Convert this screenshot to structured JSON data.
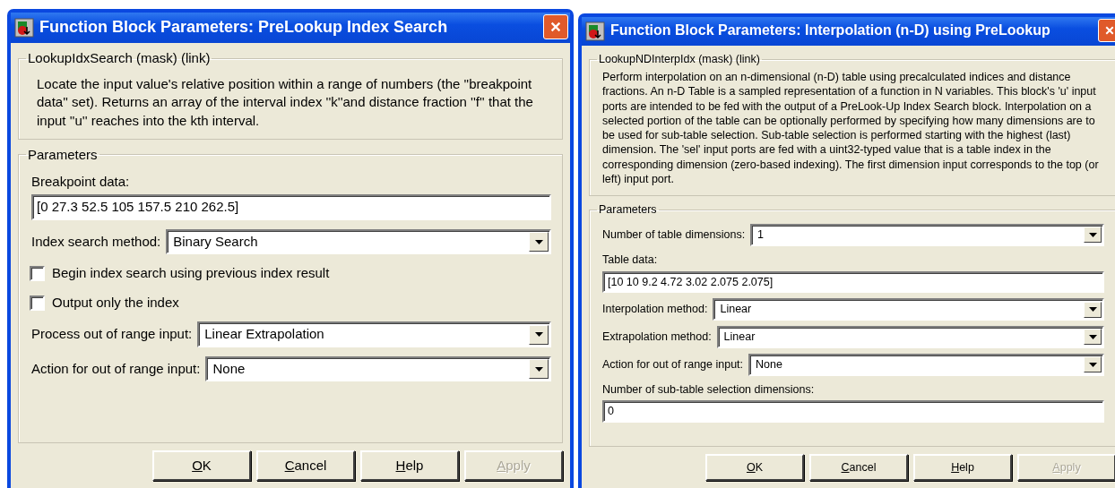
{
  "windows": [
    {
      "title": "Function Block Parameters: PreLookup Index Search",
      "description": {
        "legend": "LookupIdxSearch (mask) (link)",
        "text": "Locate the input value's relative position within a range of numbers (the ''breakpoint data'' set).  Returns an array of the interval index ''k''and distance fraction ''f'' that the input ''u'' reaches into the kth interval."
      },
      "parameters": {
        "legend": "Parameters",
        "items": [
          {
            "kind": "text",
            "label": "Breakpoint data:",
            "value": "[0 27.3 52.5 105 157.5 210 262.5]"
          },
          {
            "kind": "select",
            "label": "Index search method:",
            "value": "Binary Search"
          },
          {
            "kind": "checkbox",
            "label": "Begin index search using previous index result",
            "checked": false
          },
          {
            "kind": "checkbox",
            "label": "Output only the index",
            "checked": false
          },
          {
            "kind": "select",
            "label": "Process out of range input:",
            "value": "Linear Extrapolation"
          },
          {
            "kind": "select",
            "label": "Action for out of range input:",
            "value": "None"
          }
        ]
      },
      "buttons": [
        {
          "label": "OK",
          "underline_first": true,
          "disabled": false
        },
        {
          "label": "Cancel",
          "underline_first": true,
          "disabled": false
        },
        {
          "label": "Help",
          "underline_first": true,
          "disabled": false
        },
        {
          "label": "Apply",
          "underline_first": true,
          "disabled": true
        }
      ]
    },
    {
      "title": "Function Block Parameters: Interpolation (n-D) using PreLookup",
      "description": {
        "legend": "LookupNDInterpIdx (mask) (link)",
        "text": "Perform interpolation on an n-dimensional (n-D) table using precalculated indices and distance fractions.  An n-D Table is a sampled representation of a function in N variables.  This block's 'u' input ports are intended to be fed with the output of a PreLook-Up Index Search block.  Interpolation on a selected portion of the table can be optionally performed by specifying how many dimensions are to be used for sub-table selection.  Sub-table selection is performed starting with the highest (last) dimension.  The 'sel' input ports are fed with a uint32-typed value that is a table index in the corresponding dimension (zero-based indexing).  The first dimension input corresponds to the top (or left) input port."
      },
      "parameters": {
        "legend": "Parameters",
        "items": [
          {
            "kind": "select",
            "label": "Number of table dimensions:",
            "value": "1"
          },
          {
            "kind": "text",
            "label": "Table data:",
            "value": "[10 10 9.2 4.72 3.02 2.075 2.075]"
          },
          {
            "kind": "select",
            "label": "Interpolation method:",
            "value": "Linear"
          },
          {
            "kind": "select",
            "label": "Extrapolation method:",
            "value": "Linear"
          },
          {
            "kind": "select",
            "label": "Action for out of range input:",
            "value": "None"
          },
          {
            "kind": "text",
            "label": "Number of sub-table selection dimensions:",
            "value": "0"
          }
        ]
      },
      "buttons": [
        {
          "label": "OK",
          "underline_first": true,
          "disabled": false
        },
        {
          "label": "Cancel",
          "underline_first": true,
          "disabled": false
        },
        {
          "label": "Help",
          "underline_first": true,
          "disabled": false
        },
        {
          "label": "Apply",
          "underline_first": true,
          "disabled": true
        }
      ]
    }
  ]
}
